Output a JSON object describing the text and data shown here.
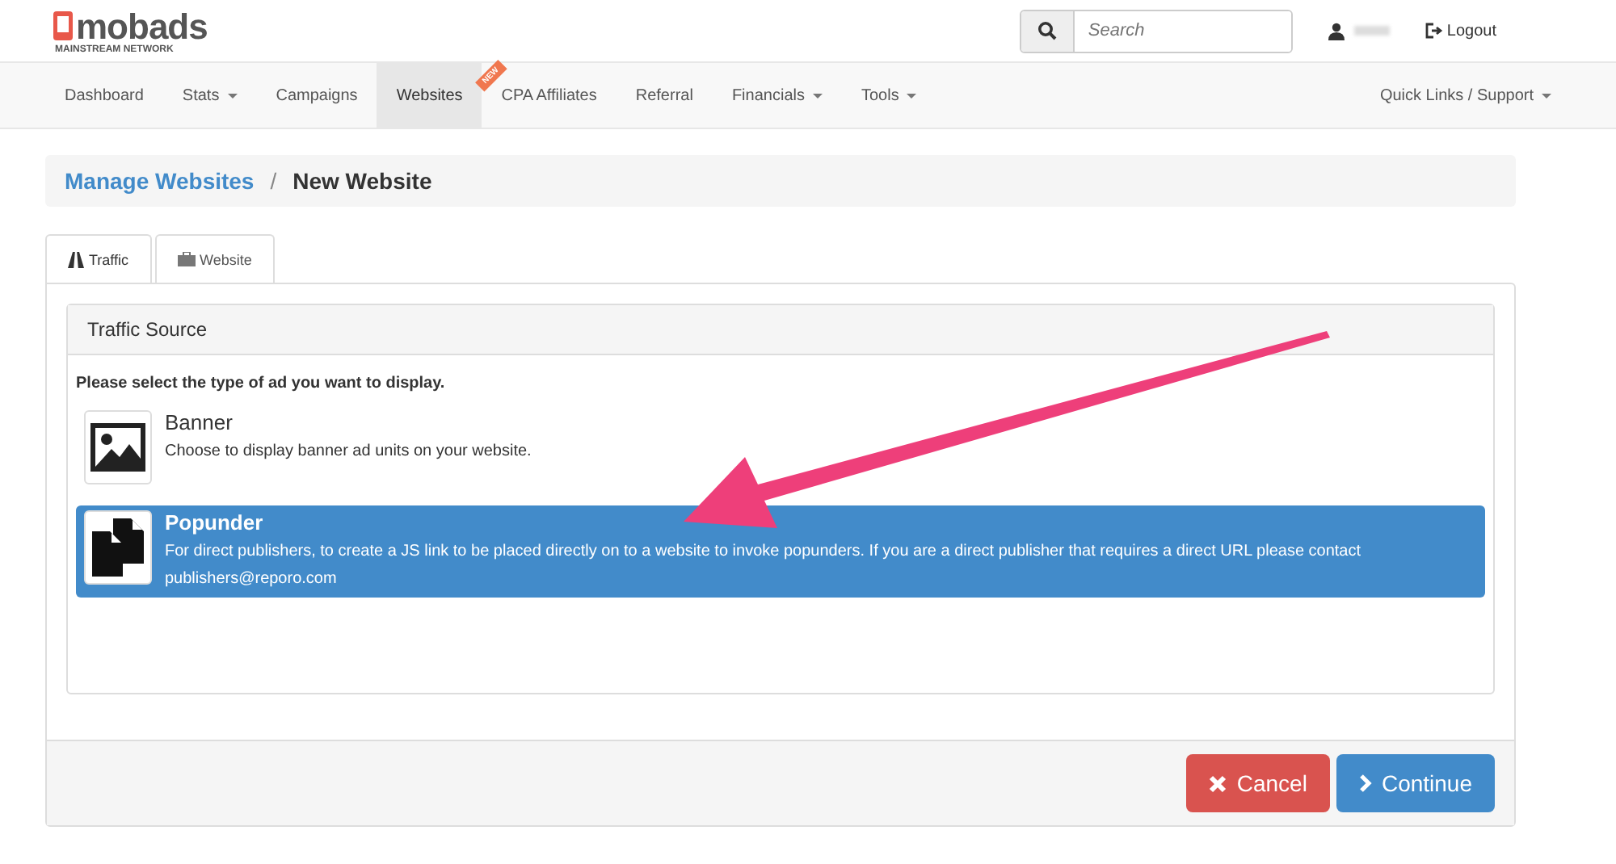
{
  "header": {
    "logo": {
      "brand": "mobads",
      "tagline": "MAINSTREAM NETWORK"
    },
    "search": {
      "placeholder": "Search"
    },
    "logout": "Logout"
  },
  "nav": {
    "items": [
      {
        "label": "Dashboard",
        "dropdown": false,
        "selected": false
      },
      {
        "label": "Stats",
        "dropdown": true,
        "selected": false
      },
      {
        "label": "Campaigns",
        "dropdown": false,
        "selected": false
      },
      {
        "label": "Websites",
        "dropdown": false,
        "selected": true
      },
      {
        "label": "CPA Affiliates",
        "dropdown": false,
        "selected": false,
        "badge": "NEW"
      },
      {
        "label": "Referral",
        "dropdown": false,
        "selected": false
      },
      {
        "label": "Financials",
        "dropdown": true,
        "selected": false
      },
      {
        "label": "Tools",
        "dropdown": true,
        "selected": false
      }
    ],
    "right": {
      "label": "Quick Links / Support",
      "dropdown": true
    }
  },
  "breadcrumb": {
    "link": "Manage Websites",
    "separator": "/",
    "current": "New Website"
  },
  "tabs": [
    {
      "label": "Traffic",
      "kind": "traffic",
      "selected": true
    },
    {
      "label": "Website",
      "kind": "website",
      "selected": false
    }
  ],
  "panel": {
    "heading": "Traffic Source",
    "prompt": "Please select the type of ad you want to display.",
    "options": [
      {
        "kind": "image",
        "title": "Banner",
        "description": "Choose to display banner ad units on your website.",
        "selected": false
      },
      {
        "kind": "files",
        "title": "Popunder",
        "description": "For direct publishers, to create a JS link to be placed directly on to a website to invoke popunders. If you are a direct publisher that requires a direct URL please contact publishers@reporo.com",
        "selected": true
      }
    ]
  },
  "buttons": [
    {
      "kind": "cancel",
      "label": "Cancel"
    },
    {
      "kind": "continue",
      "label": "Continue"
    }
  ]
}
